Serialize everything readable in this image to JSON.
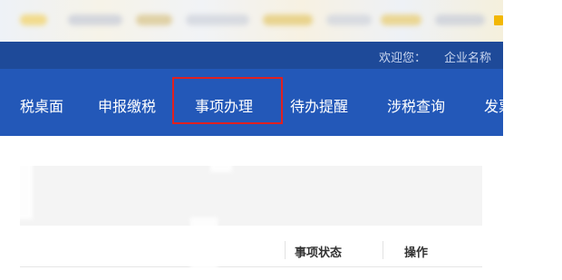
{
  "header": {
    "welcome_label": "欢迎您：",
    "company_name": "企业名称"
  },
  "nav": {
    "items": [
      {
        "label": "税桌面"
      },
      {
        "label": "申报缴税"
      },
      {
        "label": "事项办理"
      },
      {
        "label": "待办提醒"
      },
      {
        "label": "涉税查询"
      },
      {
        "label": "发票"
      }
    ],
    "highlighted_item": "事项办理"
  },
  "table": {
    "columns": [
      {
        "label": "事项状态"
      },
      {
        "label": "操作"
      }
    ]
  },
  "colors": {
    "nav_background": "#2358b8",
    "welcome_background": "#1e4a99",
    "highlight_border": "#e02020"
  }
}
